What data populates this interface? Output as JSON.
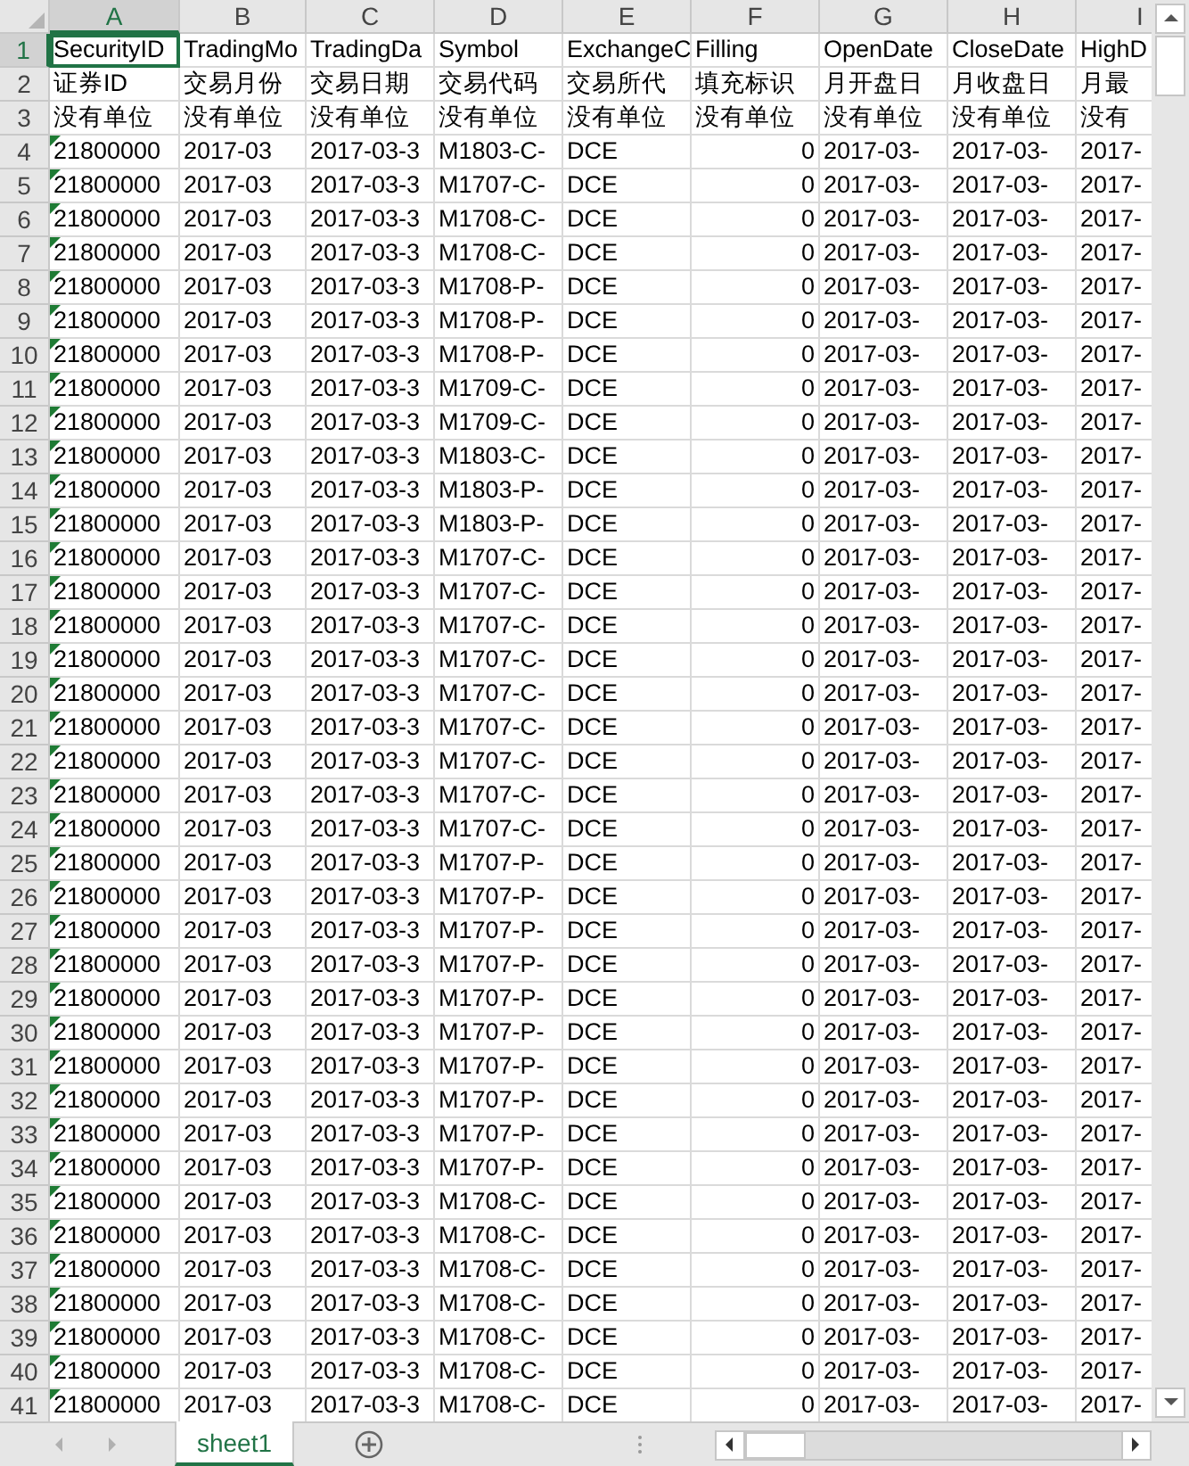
{
  "columns": [
    {
      "letter": "A",
      "selected": true,
      "numeric": false
    },
    {
      "letter": "B",
      "selected": false,
      "numeric": false
    },
    {
      "letter": "C",
      "selected": false,
      "numeric": false
    },
    {
      "letter": "D",
      "selected": false,
      "numeric": false
    },
    {
      "letter": "E",
      "selected": false,
      "numeric": false
    },
    {
      "letter": "F",
      "selected": false,
      "numeric": true
    },
    {
      "letter": "G",
      "selected": false,
      "numeric": false
    },
    {
      "letter": "H",
      "selected": false,
      "numeric": false
    },
    {
      "letter": "I",
      "selected": false,
      "numeric": false
    }
  ],
  "rows": [
    {
      "number": "1",
      "kind": "header",
      "selected": true,
      "flagged": false,
      "cells": [
        "SecurityID",
        "TradingMo",
        "TradingDa",
        "Symbol",
        "ExchangeC",
        "Filling",
        "OpenDate",
        "CloseDate",
        "HighD"
      ]
    },
    {
      "number": "2",
      "kind": "header",
      "selected": false,
      "flagged": false,
      "cells": [
        "证券ID",
        "交易月份",
        "交易日期",
        "交易代码",
        "交易所代",
        "填充标识",
        "月开盘日",
        "月收盘日",
        "月最"
      ]
    },
    {
      "number": "3",
      "kind": "header",
      "selected": false,
      "flagged": false,
      "cells": [
        "没有单位",
        "没有单位",
        "没有单位",
        "没有单位",
        "没有单位",
        "没有单位",
        "没有单位",
        "没有单位",
        "没有"
      ]
    },
    {
      "number": "4",
      "kind": "data",
      "selected": false,
      "flagged": true,
      "cells": [
        "21800000",
        "2017-03",
        "2017-03-3",
        "M1803-C-",
        "DCE",
        "0",
        "2017-03-",
        "2017-03-",
        "2017-"
      ]
    },
    {
      "number": "5",
      "kind": "data",
      "selected": false,
      "flagged": true,
      "cells": [
        "21800000",
        "2017-03",
        "2017-03-3",
        "M1707-C-",
        "DCE",
        "0",
        "2017-03-",
        "2017-03-",
        "2017-"
      ]
    },
    {
      "number": "6",
      "kind": "data",
      "selected": false,
      "flagged": true,
      "cells": [
        "21800000",
        "2017-03",
        "2017-03-3",
        "M1708-C-",
        "DCE",
        "0",
        "2017-03-",
        "2017-03-",
        "2017-"
      ]
    },
    {
      "number": "7",
      "kind": "data",
      "selected": false,
      "flagged": true,
      "cells": [
        "21800000",
        "2017-03",
        "2017-03-3",
        "M1708-C-",
        "DCE",
        "0",
        "2017-03-",
        "2017-03-",
        "2017-"
      ]
    },
    {
      "number": "8",
      "kind": "data",
      "selected": false,
      "flagged": true,
      "cells": [
        "21800000",
        "2017-03",
        "2017-03-3",
        "M1708-P-",
        "DCE",
        "0",
        "2017-03-",
        "2017-03-",
        "2017-"
      ]
    },
    {
      "number": "9",
      "kind": "data",
      "selected": false,
      "flagged": true,
      "cells": [
        "21800000",
        "2017-03",
        "2017-03-3",
        "M1708-P-",
        "DCE",
        "0",
        "2017-03-",
        "2017-03-",
        "2017-"
      ]
    },
    {
      "number": "10",
      "kind": "data",
      "selected": false,
      "flagged": true,
      "cells": [
        "21800000",
        "2017-03",
        "2017-03-3",
        "M1708-P-",
        "DCE",
        "0",
        "2017-03-",
        "2017-03-",
        "2017-"
      ]
    },
    {
      "number": "11",
      "kind": "data",
      "selected": false,
      "flagged": true,
      "cells": [
        "21800000",
        "2017-03",
        "2017-03-3",
        "M1709-C-",
        "DCE",
        "0",
        "2017-03-",
        "2017-03-",
        "2017-"
      ]
    },
    {
      "number": "12",
      "kind": "data",
      "selected": false,
      "flagged": true,
      "cells": [
        "21800000",
        "2017-03",
        "2017-03-3",
        "M1709-C-",
        "DCE",
        "0",
        "2017-03-",
        "2017-03-",
        "2017-"
      ]
    },
    {
      "number": "13",
      "kind": "data",
      "selected": false,
      "flagged": true,
      "cells": [
        "21800000",
        "2017-03",
        "2017-03-3",
        "M1803-C-",
        "DCE",
        "0",
        "2017-03-",
        "2017-03-",
        "2017-"
      ]
    },
    {
      "number": "14",
      "kind": "data",
      "selected": false,
      "flagged": true,
      "cells": [
        "21800000",
        "2017-03",
        "2017-03-3",
        "M1803-P-",
        "DCE",
        "0",
        "2017-03-",
        "2017-03-",
        "2017-"
      ]
    },
    {
      "number": "15",
      "kind": "data",
      "selected": false,
      "flagged": true,
      "cells": [
        "21800000",
        "2017-03",
        "2017-03-3",
        "M1803-P-",
        "DCE",
        "0",
        "2017-03-",
        "2017-03-",
        "2017-"
      ]
    },
    {
      "number": "16",
      "kind": "data",
      "selected": false,
      "flagged": true,
      "cells": [
        "21800000",
        "2017-03",
        "2017-03-3",
        "M1707-C-",
        "DCE",
        "0",
        "2017-03-",
        "2017-03-",
        "2017-"
      ]
    },
    {
      "number": "17",
      "kind": "data",
      "selected": false,
      "flagged": true,
      "cells": [
        "21800000",
        "2017-03",
        "2017-03-3",
        "M1707-C-",
        "DCE",
        "0",
        "2017-03-",
        "2017-03-",
        "2017-"
      ]
    },
    {
      "number": "18",
      "kind": "data",
      "selected": false,
      "flagged": true,
      "cells": [
        "21800000",
        "2017-03",
        "2017-03-3",
        "M1707-C-",
        "DCE",
        "0",
        "2017-03-",
        "2017-03-",
        "2017-"
      ]
    },
    {
      "number": "19",
      "kind": "data",
      "selected": false,
      "flagged": true,
      "cells": [
        "21800000",
        "2017-03",
        "2017-03-3",
        "M1707-C-",
        "DCE",
        "0",
        "2017-03-",
        "2017-03-",
        "2017-"
      ]
    },
    {
      "number": "20",
      "kind": "data",
      "selected": false,
      "flagged": true,
      "cells": [
        "21800000",
        "2017-03",
        "2017-03-3",
        "M1707-C-",
        "DCE",
        "0",
        "2017-03-",
        "2017-03-",
        "2017-"
      ]
    },
    {
      "number": "21",
      "kind": "data",
      "selected": false,
      "flagged": true,
      "cells": [
        "21800000",
        "2017-03",
        "2017-03-3",
        "M1707-C-",
        "DCE",
        "0",
        "2017-03-",
        "2017-03-",
        "2017-"
      ]
    },
    {
      "number": "22",
      "kind": "data",
      "selected": false,
      "flagged": true,
      "cells": [
        "21800000",
        "2017-03",
        "2017-03-3",
        "M1707-C-",
        "DCE",
        "0",
        "2017-03-",
        "2017-03-",
        "2017-"
      ]
    },
    {
      "number": "23",
      "kind": "data",
      "selected": false,
      "flagged": true,
      "cells": [
        "21800000",
        "2017-03",
        "2017-03-3",
        "M1707-C-",
        "DCE",
        "0",
        "2017-03-",
        "2017-03-",
        "2017-"
      ]
    },
    {
      "number": "24",
      "kind": "data",
      "selected": false,
      "flagged": true,
      "cells": [
        "21800000",
        "2017-03",
        "2017-03-3",
        "M1707-C-",
        "DCE",
        "0",
        "2017-03-",
        "2017-03-",
        "2017-"
      ]
    },
    {
      "number": "25",
      "kind": "data",
      "selected": false,
      "flagged": true,
      "cells": [
        "21800000",
        "2017-03",
        "2017-03-3",
        "M1707-P-",
        "DCE",
        "0",
        "2017-03-",
        "2017-03-",
        "2017-"
      ]
    },
    {
      "number": "26",
      "kind": "data",
      "selected": false,
      "flagged": true,
      "cells": [
        "21800000",
        "2017-03",
        "2017-03-3",
        "M1707-P-",
        "DCE",
        "0",
        "2017-03-",
        "2017-03-",
        "2017-"
      ]
    },
    {
      "number": "27",
      "kind": "data",
      "selected": false,
      "flagged": true,
      "cells": [
        "21800000",
        "2017-03",
        "2017-03-3",
        "M1707-P-",
        "DCE",
        "0",
        "2017-03-",
        "2017-03-",
        "2017-"
      ]
    },
    {
      "number": "28",
      "kind": "data",
      "selected": false,
      "flagged": true,
      "cells": [
        "21800000",
        "2017-03",
        "2017-03-3",
        "M1707-P-",
        "DCE",
        "0",
        "2017-03-",
        "2017-03-",
        "2017-"
      ]
    },
    {
      "number": "29",
      "kind": "data",
      "selected": false,
      "flagged": true,
      "cells": [
        "21800000",
        "2017-03",
        "2017-03-3",
        "M1707-P-",
        "DCE",
        "0",
        "2017-03-",
        "2017-03-",
        "2017-"
      ]
    },
    {
      "number": "30",
      "kind": "data",
      "selected": false,
      "flagged": true,
      "cells": [
        "21800000",
        "2017-03",
        "2017-03-3",
        "M1707-P-",
        "DCE",
        "0",
        "2017-03-",
        "2017-03-",
        "2017-"
      ]
    },
    {
      "number": "31",
      "kind": "data",
      "selected": false,
      "flagged": true,
      "cells": [
        "21800000",
        "2017-03",
        "2017-03-3",
        "M1707-P-",
        "DCE",
        "0",
        "2017-03-",
        "2017-03-",
        "2017-"
      ]
    },
    {
      "number": "32",
      "kind": "data",
      "selected": false,
      "flagged": true,
      "cells": [
        "21800000",
        "2017-03",
        "2017-03-3",
        "M1707-P-",
        "DCE",
        "0",
        "2017-03-",
        "2017-03-",
        "2017-"
      ]
    },
    {
      "number": "33",
      "kind": "data",
      "selected": false,
      "flagged": true,
      "cells": [
        "21800000",
        "2017-03",
        "2017-03-3",
        "M1707-P-",
        "DCE",
        "0",
        "2017-03-",
        "2017-03-",
        "2017-"
      ]
    },
    {
      "number": "34",
      "kind": "data",
      "selected": false,
      "flagged": true,
      "cells": [
        "21800000",
        "2017-03",
        "2017-03-3",
        "M1707-P-",
        "DCE",
        "0",
        "2017-03-",
        "2017-03-",
        "2017-"
      ]
    },
    {
      "number": "35",
      "kind": "data",
      "selected": false,
      "flagged": true,
      "cells": [
        "21800000",
        "2017-03",
        "2017-03-3",
        "M1708-C-",
        "DCE",
        "0",
        "2017-03-",
        "2017-03-",
        "2017-"
      ]
    },
    {
      "number": "36",
      "kind": "data",
      "selected": false,
      "flagged": true,
      "cells": [
        "21800000",
        "2017-03",
        "2017-03-3",
        "M1708-C-",
        "DCE",
        "0",
        "2017-03-",
        "2017-03-",
        "2017-"
      ]
    },
    {
      "number": "37",
      "kind": "data",
      "selected": false,
      "flagged": true,
      "cells": [
        "21800000",
        "2017-03",
        "2017-03-3",
        "M1708-C-",
        "DCE",
        "0",
        "2017-03-",
        "2017-03-",
        "2017-"
      ]
    },
    {
      "number": "38",
      "kind": "data",
      "selected": false,
      "flagged": true,
      "cells": [
        "21800000",
        "2017-03",
        "2017-03-3",
        "M1708-C-",
        "DCE",
        "0",
        "2017-03-",
        "2017-03-",
        "2017-"
      ]
    },
    {
      "number": "39",
      "kind": "data",
      "selected": false,
      "flagged": true,
      "cells": [
        "21800000",
        "2017-03",
        "2017-03-3",
        "M1708-C-",
        "DCE",
        "0",
        "2017-03-",
        "2017-03-",
        "2017-"
      ]
    },
    {
      "number": "40",
      "kind": "data",
      "selected": false,
      "flagged": true,
      "cells": [
        "21800000",
        "2017-03",
        "2017-03-3",
        "M1708-C-",
        "DCE",
        "0",
        "2017-03-",
        "2017-03-",
        "2017-"
      ]
    },
    {
      "number": "41",
      "kind": "data",
      "selected": false,
      "flagged": true,
      "cells": [
        "21800000",
        "2017-03",
        "2017-03-3",
        "M1708-C-",
        "DCE",
        "0",
        "2017-03-",
        "2017-03-",
        "2017-"
      ]
    }
  ],
  "sheet_tabs": [
    {
      "label": "sheet1",
      "selected": true
    }
  ]
}
